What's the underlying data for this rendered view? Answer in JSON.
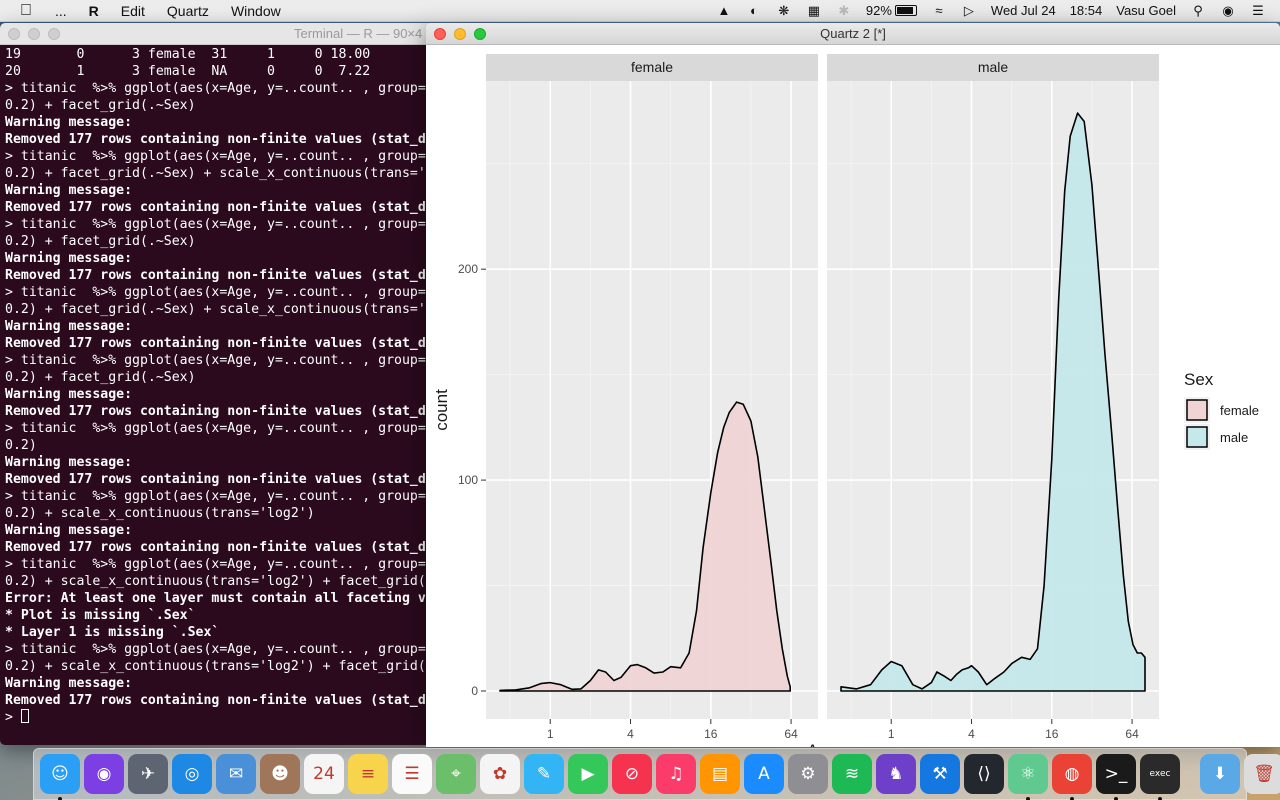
{
  "menubar": {
    "app_name": "R",
    "menus": [
      "Edit",
      "Quartz",
      "Window"
    ],
    "ellipsis": "...",
    "battery_percent": "92%",
    "battery_level": 0.92,
    "date": "Wed Jul 24",
    "time": "18:54",
    "user": "Vasu Goel",
    "status_icons": [
      "alfred-hat-icon",
      "contrast-icon",
      "bear-icon",
      "grid-icon",
      "bluetooth-icon"
    ]
  },
  "terminal": {
    "title": "Terminal — R — 90×4",
    "lines": [
      {
        "text": "19       0      3 female  31     1     0 18.00",
        "bold": false
      },
      {
        "text": "20       1      3 female  NA     0     0  7.22",
        "bold": false
      },
      {
        "text": "> titanic  %>% ggplot(aes(x=Age, y=..count.. , group=",
        "bold": false
      },
      {
        "text": "0.2) + facet_grid(.~Sex)",
        "bold": false
      },
      {
        "text": "Warning message:",
        "bold": true
      },
      {
        "text": "Removed 177 rows containing non-finite values (stat_d",
        "bold": true
      },
      {
        "text": "> titanic  %>% ggplot(aes(x=Age, y=..count.. , group=",
        "bold": false
      },
      {
        "text": "0.2) + facet_grid(.~Sex) + scale_x_continuous(trans='",
        "bold": false
      },
      {
        "text": "Warning message:",
        "bold": true
      },
      {
        "text": "Removed 177 rows containing non-finite values (stat_d",
        "bold": true
      },
      {
        "text": "> titanic  %>% ggplot(aes(x=Age, y=..count.. , group=",
        "bold": false
      },
      {
        "text": "0.2) + facet_grid(.~Sex)",
        "bold": false
      },
      {
        "text": "Warning message:",
        "bold": true
      },
      {
        "text": "Removed 177 rows containing non-finite values (stat_d",
        "bold": true
      },
      {
        "text": "> titanic  %>% ggplot(aes(x=Age, y=..count.. , group=",
        "bold": false
      },
      {
        "text": "0.2) + facet_grid(.~Sex) + scale_x_continuous(trans='",
        "bold": false
      },
      {
        "text": "Warning message:",
        "bold": true
      },
      {
        "text": "Removed 177 rows containing non-finite values (stat_d",
        "bold": true
      },
      {
        "text": "> titanic  %>% ggplot(aes(x=Age, y=..count.. , group=",
        "bold": false
      },
      {
        "text": "0.2) + facet_grid(.~Sex)",
        "bold": false
      },
      {
        "text": "Warning message:",
        "bold": true
      },
      {
        "text": "Removed 177 rows containing non-finite values (stat_d",
        "bold": true
      },
      {
        "text": "> titanic  %>% ggplot(aes(x=Age, y=..count.. , group=",
        "bold": false
      },
      {
        "text": "0.2)",
        "bold": false
      },
      {
        "text": "Warning message:",
        "bold": true
      },
      {
        "text": "Removed 177 rows containing non-finite values (stat_d",
        "bold": true
      },
      {
        "text": "> titanic  %>% ggplot(aes(x=Age, y=..count.. , group=",
        "bold": false
      },
      {
        "text": "0.2) + scale_x_continuous(trans='log2')",
        "bold": false
      },
      {
        "text": "Warning message:",
        "bold": true
      },
      {
        "text": "Removed 177 rows containing non-finite values (stat_d",
        "bold": true
      },
      {
        "text": "> titanic  %>% ggplot(aes(x=Age, y=..count.. , group=",
        "bold": false
      },
      {
        "text": "0.2) + scale_x_continuous(trans='log2') + facet_grid(",
        "bold": false
      },
      {
        "text": "Error: At least one layer must contain all faceting v",
        "bold": true
      },
      {
        "text": "* Plot is missing `.Sex`",
        "bold": true
      },
      {
        "text": "* Layer 1 is missing `.Sex`",
        "bold": true
      },
      {
        "text": "> titanic  %>% ggplot(aes(x=Age, y=..count.. , group=",
        "bold": false
      },
      {
        "text": "0.2) + scale_x_continuous(trans='log2') + facet_grid(",
        "bold": false
      },
      {
        "text": "Warning message:",
        "bold": true
      },
      {
        "text": "Removed 177 rows containing non-finite values (stat_d",
        "bold": true
      }
    ],
    "prompt": "> "
  },
  "quartz": {
    "title": "Quartz 2 [*]"
  },
  "chart_data": {
    "type": "area",
    "facets": [
      "female",
      "male"
    ],
    "xlabel": "Age",
    "ylabel": "count",
    "x_scale": "log2",
    "x_ticks": [
      1,
      4,
      16,
      64
    ],
    "x_tick_labels": [
      "1",
      "4",
      "16",
      "64"
    ],
    "x_range": [
      0.42,
      80
    ],
    "y_ticks": [
      0,
      100,
      200
    ],
    "y_tick_labels": [
      "0",
      "100",
      "200"
    ],
    "ylim": [
      0,
      275
    ],
    "grid": true,
    "legend": {
      "title": "Sex",
      "position": "right",
      "entries": [
        "female",
        "male"
      ]
    },
    "series": [
      {
        "name": "female",
        "fill": "#f0d4d5",
        "x": [
          0.42,
          0.55,
          0.7,
          0.85,
          1.0,
          1.2,
          1.45,
          1.7,
          2.0,
          2.3,
          2.6,
          3.0,
          3.4,
          4.0,
          4.5,
          5.2,
          6.0,
          7.0,
          8.0,
          9.5,
          11,
          12.5,
          14,
          16,
          18,
          20,
          22,
          25,
          28,
          32,
          36,
          40,
          45,
          50,
          55,
          60,
          63
        ],
        "values": [
          0.3,
          0.5,
          1.5,
          3.5,
          4,
          3,
          0.8,
          1,
          5,
          10,
          9,
          5,
          6.5,
          12,
          12.5,
          11,
          8.5,
          9,
          11.5,
          11,
          18,
          38,
          68,
          94,
          113,
          125,
          132,
          137,
          136,
          128,
          111,
          88,
          62,
          38,
          20,
          7,
          2
        ]
      },
      {
        "name": "male",
        "fill": "#c5e8ea",
        "x": [
          0.42,
          0.55,
          0.7,
          0.85,
          1.0,
          1.2,
          1.45,
          1.7,
          2.0,
          2.2,
          2.5,
          2.8,
          3.1,
          3.4,
          3.8,
          4.0,
          4.5,
          5.2,
          6.0,
          7.0,
          8.0,
          9.5,
          11,
          12.5,
          14,
          16,
          18,
          20,
          22,
          25,
          28,
          32,
          36,
          40,
          45,
          50,
          55,
          60,
          65,
          70,
          75,
          80
        ],
        "values": [
          2,
          1,
          3,
          10,
          14,
          12,
          3,
          1,
          4,
          9,
          7,
          5,
          8,
          10,
          11,
          12,
          9,
          3,
          6,
          9,
          13,
          16,
          15,
          20,
          50,
          110,
          185,
          237,
          263,
          274,
          270,
          240,
          198,
          160,
          122,
          86,
          55,
          33,
          22,
          18,
          18,
          16
        ]
      }
    ]
  },
  "dock": {
    "items": [
      {
        "name": "finder-icon",
        "color": "#2b9ef5",
        "glyph": "☺",
        "running": true
      },
      {
        "name": "siri-icon",
        "color": "#7b3fe4",
        "glyph": "◉",
        "running": false
      },
      {
        "name": "launchpad-icon",
        "color": "#5d6472",
        "glyph": "✈",
        "running": false
      },
      {
        "name": "safari-icon",
        "color": "#1e88e5",
        "glyph": "◎",
        "running": false
      },
      {
        "name": "mail-icon",
        "color": "#4a90d9",
        "glyph": "✉",
        "running": false
      },
      {
        "name": "contacts-icon",
        "color": "#a0765b",
        "glyph": "☻",
        "running": false
      },
      {
        "name": "calendar-icon",
        "color": "#f5f5f5",
        "glyph": "24",
        "running": false
      },
      {
        "name": "notes-icon",
        "color": "#f7d44c",
        "glyph": "≡",
        "running": false
      },
      {
        "name": "reminders-icon",
        "color": "#fafafa",
        "glyph": "☰",
        "running": false
      },
      {
        "name": "maps-icon",
        "color": "#6bbf6b",
        "glyph": "⌖",
        "running": false
      },
      {
        "name": "photos-icon",
        "color": "#f4f4f4",
        "glyph": "✿",
        "running": false
      },
      {
        "name": "messages-icon",
        "color": "#33b5f5",
        "glyph": "✎",
        "running": false
      },
      {
        "name": "facetime-icon",
        "color": "#34c759",
        "glyph": "▶",
        "running": false
      },
      {
        "name": "news-icon",
        "color": "#f5334f",
        "glyph": "⊘",
        "running": false
      },
      {
        "name": "music-icon",
        "color": "#fb3c6a",
        "glyph": "♫",
        "running": false
      },
      {
        "name": "books-icon",
        "color": "#ff9500",
        "glyph": "▤",
        "running": false
      },
      {
        "name": "app-store-icon",
        "color": "#1a8cff",
        "glyph": "A",
        "running": false
      },
      {
        "name": "system-preferences-icon",
        "color": "#8e8e93",
        "glyph": "⚙",
        "running": false
      },
      {
        "name": "spotify-icon",
        "color": "#1db954",
        "glyph": "≋",
        "running": false
      },
      {
        "name": "github-desktop-icon",
        "color": "#6e40c9",
        "glyph": "♞",
        "running": false
      },
      {
        "name": "xcode-icon",
        "color": "#1578e0",
        "glyph": "⚒",
        "running": false
      },
      {
        "name": "vscode-icon",
        "color": "#23282e",
        "glyph": "⟨⟩",
        "running": false
      },
      {
        "name": "atom-icon",
        "color": "#5fc98f",
        "glyph": "⚛",
        "running": true
      },
      {
        "name": "chrome-icon",
        "color": "#ea4335",
        "glyph": "◍",
        "running": true
      },
      {
        "name": "terminal-icon",
        "color": "#1a1a1a",
        "glyph": ">_",
        "running": true
      },
      {
        "name": "exec-icon",
        "color": "#2a2a2a",
        "glyph": "exec",
        "running": true
      },
      {
        "name": "downloads-folder-icon",
        "color": "#5aa9e6",
        "glyph": "⬇",
        "running": false,
        "after_separator": true
      },
      {
        "name": "trash-icon",
        "color": "#dcdcdc",
        "glyph": "🗑",
        "running": false
      }
    ]
  }
}
